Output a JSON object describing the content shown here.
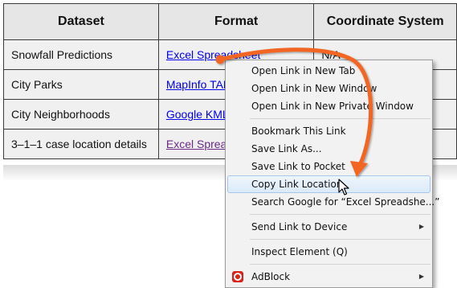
{
  "table": {
    "headers": [
      "Dataset",
      "Format",
      "Coordinate System"
    ],
    "rows": [
      {
        "dataset": "Snowfall Predictions",
        "format": "Excel Spreadsheet",
        "coord": "N/A"
      },
      {
        "dataset": "City Parks",
        "format": "MapInfo TAB",
        "coord": ""
      },
      {
        "dataset": "City Neighborhoods",
        "format": "Google KML",
        "coord": ""
      },
      {
        "dataset": "3–1–1 case location details",
        "format": "Excel Spreadsheet",
        "coord": ""
      }
    ]
  },
  "context_menu": {
    "items": [
      {
        "label": "Open Link in New Tab"
      },
      {
        "label": "Open Link in New Window"
      },
      {
        "label": "Open Link in New Private Window"
      },
      {
        "label": "Bookmark This Link"
      },
      {
        "label": "Save Link As..."
      },
      {
        "label": "Save Link to Pocket"
      },
      {
        "label": "Copy Link Location",
        "highlighted": true
      },
      {
        "label": "Search Google for “Excel Spreadshe...”"
      },
      {
        "label": "Send Link to Device",
        "submenu": true
      },
      {
        "label": "Inspect Element (Q)"
      },
      {
        "label": "AdBlock",
        "icon": "adblock-icon",
        "submenu": true
      }
    ]
  },
  "annotation": {
    "color": "#f26522",
    "icon": "curved-arrow-icon"
  },
  "colors": {
    "link": "#0000ee",
    "visited_link": "#6b2a8a",
    "highlight_border": "#a7c7ec"
  }
}
